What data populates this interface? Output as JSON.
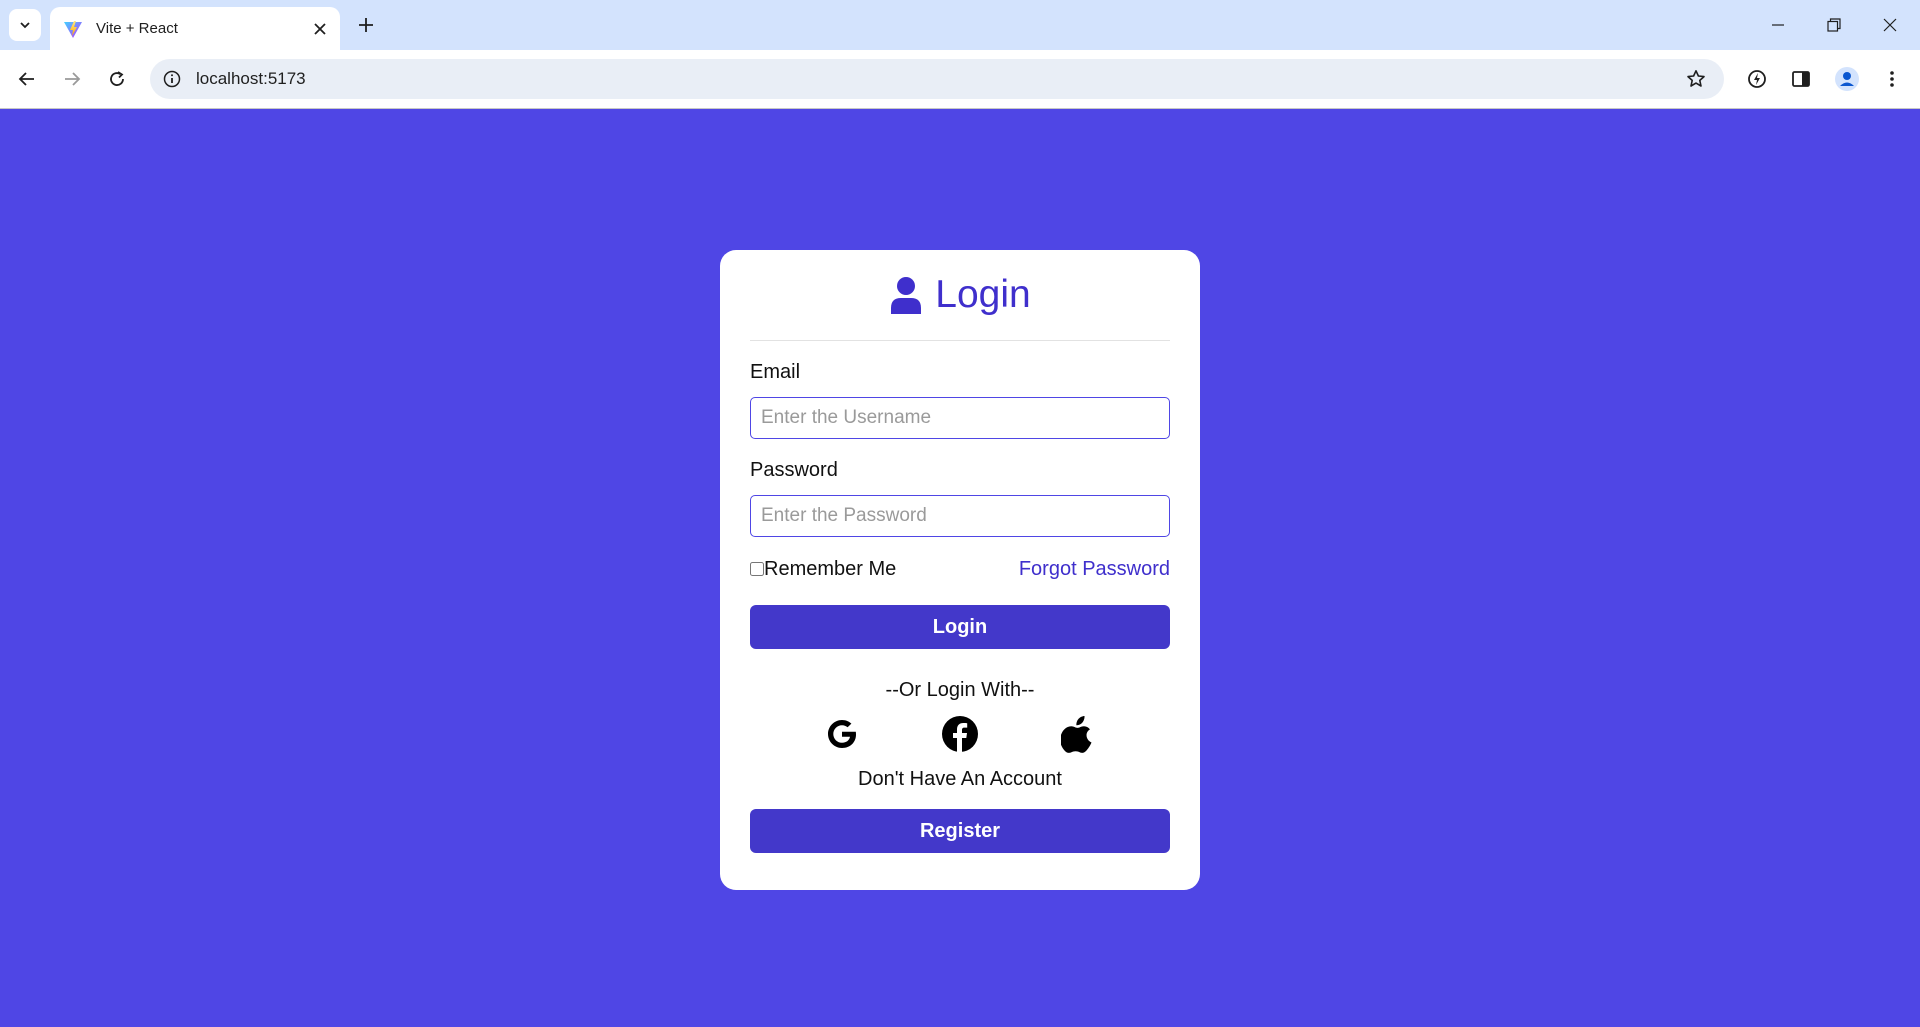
{
  "browser": {
    "tab_title": "Vite + React",
    "url": "localhost:5173"
  },
  "login": {
    "title": "Login",
    "email_label": "Email",
    "email_placeholder": "Enter the Username",
    "email_value": "",
    "password_label": "Password",
    "password_placeholder": "Enter the Password",
    "password_value": "",
    "remember_label": "Remember Me",
    "remember_checked": false,
    "forgot_label": "Forgot Password",
    "login_button": "Login",
    "alt_login_text": "--Or Login With--",
    "social_icons": [
      "google-icon",
      "facebook-icon",
      "apple-icon"
    ],
    "no_account_text": "Don't Have An Account",
    "register_button": "Register"
  },
  "colors": {
    "page_background": "#4f46e5",
    "accent": "#4338ca",
    "title": "#3f2fcc"
  }
}
